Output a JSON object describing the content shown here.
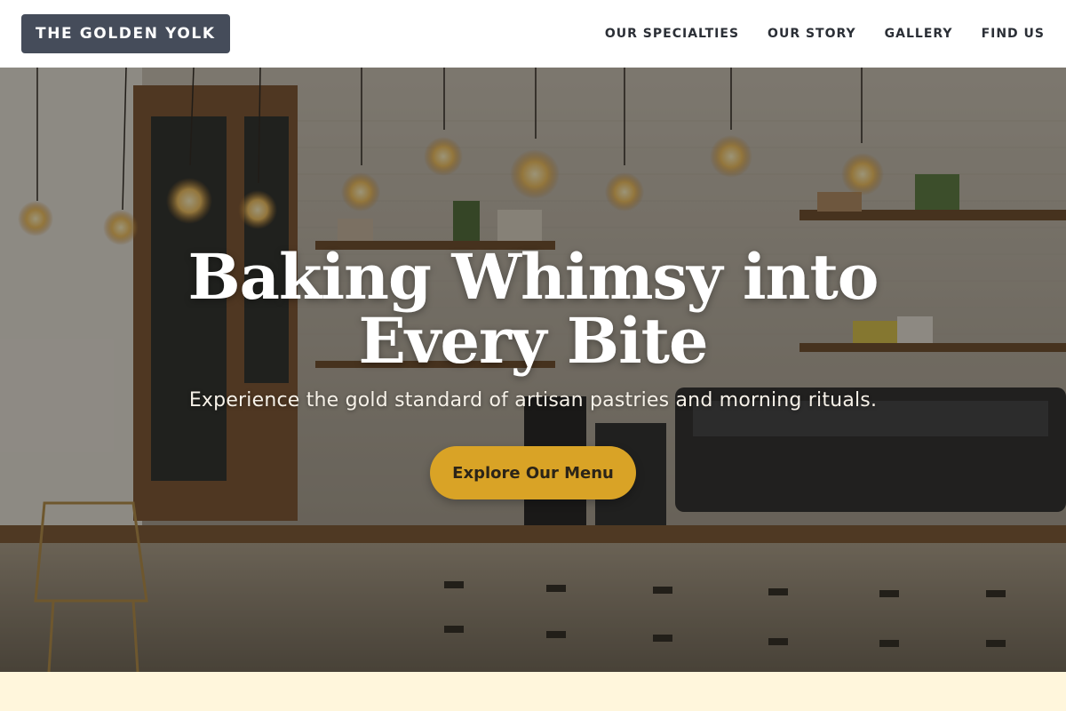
{
  "brand": {
    "name": "THE GOLDEN YOLK"
  },
  "nav": {
    "items": [
      {
        "label": "OUR SPECIALTIES"
      },
      {
        "label": "OUR STORY"
      },
      {
        "label": "GALLERY"
      },
      {
        "label": "FIND US"
      }
    ]
  },
  "hero": {
    "title": "Baking Whimsy into Every Bite",
    "subtitle": "Experience the gold standard of artisan pastries and morning rituals.",
    "cta_label": "Explore Our Menu",
    "background_image": "cafe-interior-photo"
  },
  "colors": {
    "logo_bg": "#454c5a",
    "cta_bg": "#d9a326",
    "next_section_bg": "#fff6dc"
  }
}
